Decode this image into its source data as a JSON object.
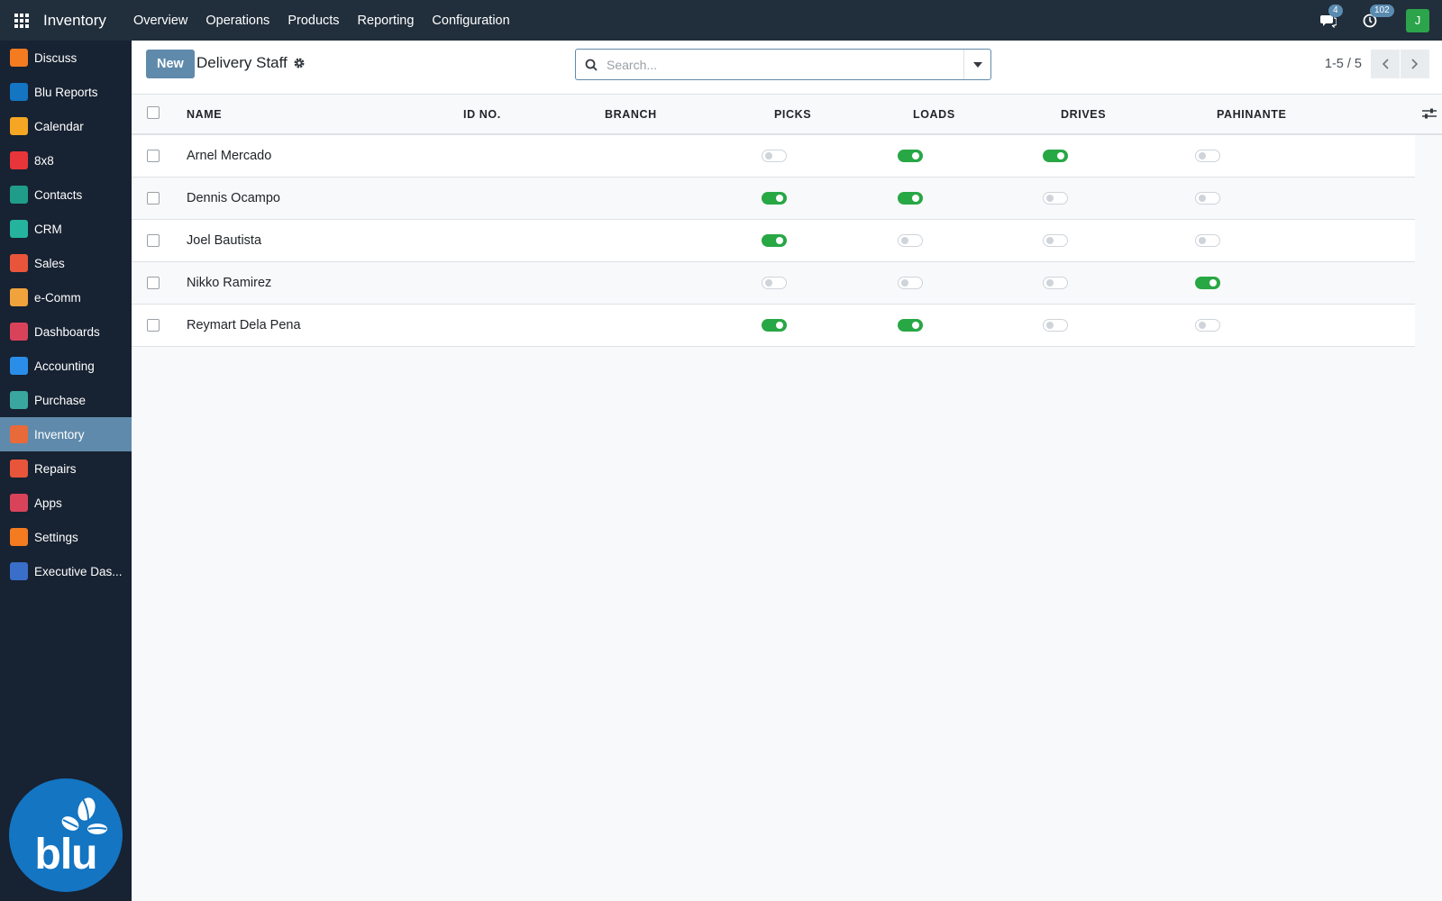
{
  "navbar": {
    "app_title": "Inventory",
    "menu": [
      "Overview",
      "Operations",
      "Products",
      "Reporting",
      "Configuration"
    ],
    "messages_count": "4",
    "activities_count": "102",
    "user_initial": "J"
  },
  "sidebar": {
    "items": [
      {
        "label": "Discuss",
        "icon": "discuss-icon",
        "color": "#f47b20"
      },
      {
        "label": "Blu Reports",
        "icon": "blu-reports-icon",
        "color": "#1475c2"
      },
      {
        "label": "Calendar",
        "icon": "calendar-icon",
        "color": "#f5a623"
      },
      {
        "label": "8x8",
        "icon": "8x8-icon",
        "color": "#e8353a"
      },
      {
        "label": "Contacts",
        "icon": "contacts-icon",
        "color": "#1f9d8a"
      },
      {
        "label": "CRM",
        "icon": "crm-icon",
        "color": "#25b39e"
      },
      {
        "label": "Sales",
        "icon": "sales-icon",
        "color": "#e8553a"
      },
      {
        "label": "e-Comm",
        "icon": "ecomm-icon",
        "color": "#f0a33c"
      },
      {
        "label": "Dashboards",
        "icon": "dashboards-icon",
        "color": "#d9435a"
      },
      {
        "label": "Accounting",
        "icon": "accounting-icon",
        "color": "#2a8ee8"
      },
      {
        "label": "Purchase",
        "icon": "purchase-icon",
        "color": "#3aa6a0"
      },
      {
        "label": "Inventory",
        "icon": "inventory-icon",
        "color": "#e86a3a",
        "active": true
      },
      {
        "label": "Repairs",
        "icon": "repairs-icon",
        "color": "#e8553a"
      },
      {
        "label": "Apps",
        "icon": "apps-icon",
        "color": "#d9435a"
      },
      {
        "label": "Settings",
        "icon": "settings-icon",
        "color": "#f47b20"
      },
      {
        "label": "Executive Das...",
        "icon": "executive-dashboard-icon",
        "color": "#3a6fc9"
      }
    ],
    "brand": "blu"
  },
  "control": {
    "new_label": "New",
    "breadcrumb": "Delivery Staff",
    "search_placeholder": "Search...",
    "pager": "1-5 / 5"
  },
  "table": {
    "columns": [
      "NAME",
      "ID NO.",
      "BRANCH",
      "PICKS",
      "LOADS",
      "DRIVES",
      "PAHINANTE"
    ],
    "rows": [
      {
        "name": "Arnel Mercado",
        "id_no": "",
        "branch": "",
        "picks": false,
        "loads": true,
        "drives": true,
        "pahinante": false
      },
      {
        "name": "Dennis Ocampo",
        "id_no": "",
        "branch": "",
        "picks": true,
        "loads": true,
        "drives": false,
        "pahinante": false
      },
      {
        "name": "Joel Bautista",
        "id_no": "",
        "branch": "",
        "picks": true,
        "loads": false,
        "drives": false,
        "pahinante": false
      },
      {
        "name": "Nikko Ramirez",
        "id_no": "",
        "branch": "",
        "picks": false,
        "loads": false,
        "drives": false,
        "pahinante": true
      },
      {
        "name": "Reymart Dela Pena",
        "id_no": "",
        "branch": "",
        "picks": true,
        "loads": true,
        "drives": false,
        "pahinante": false
      }
    ]
  },
  "colors": {
    "navbar": "#212e3b",
    "sidebar": "#172232",
    "accent": "#5f8aab",
    "toggle_on": "#28a745",
    "brand_blue": "#1475c2"
  }
}
